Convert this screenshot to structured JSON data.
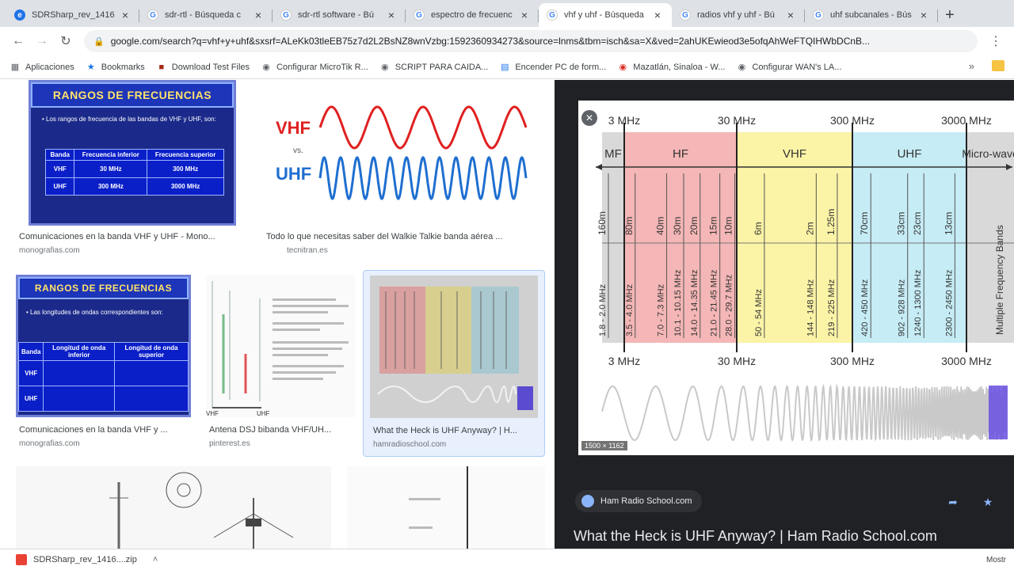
{
  "tabs": [
    {
      "title": "SDRSharp_rev_1416",
      "icon": "edge",
      "active": false
    },
    {
      "title": "sdr-rtl - Búsqueda c",
      "icon": "g",
      "active": false
    },
    {
      "title": "sdr-rtl software - Bú",
      "icon": "g",
      "active": false
    },
    {
      "title": "espectro de frecuenc",
      "icon": "g",
      "active": false
    },
    {
      "title": "vhf y uhf - Búsqueda",
      "icon": "g",
      "active": true
    },
    {
      "title": "radios vhf y uhf - Bú",
      "icon": "g",
      "active": false
    },
    {
      "title": "uhf subcanales - Bús",
      "icon": "g",
      "active": false
    }
  ],
  "toolbar": {
    "url": "google.com/search?q=vhf+y+uhf&sxsrf=ALeKk03tleEB75z7d2L2BsNZ8wnVzbg:1592360934273&source=lnms&tbm=isch&sa=X&ved=2ahUKEwieod3e5ofqAhWeFTQIHWbDCnB..."
  },
  "bookmarks": [
    {
      "label": "Aplicaciones",
      "icon": "apps"
    },
    {
      "label": "Bookmarks",
      "icon": "star"
    },
    {
      "label": "Download Test Files",
      "icon": "square"
    },
    {
      "label": "Configurar MicroTik R...",
      "icon": "circle"
    },
    {
      "label": "SCRIPT PARA CAIDA...",
      "icon": "circle"
    },
    {
      "label": "Encender PC de form...",
      "icon": "doc"
    },
    {
      "label": "Mazatlán, Sinaloa - W...",
      "icon": "circle-red"
    },
    {
      "label": "Configurar WAN's LA...",
      "icon": "circle"
    }
  ],
  "results": {
    "r1": {
      "caption": "Comunicaciones en la banda VHF y UHF - Mono...",
      "source": "monografias.com",
      "panel_title": "RANGOS DE FRECUENCIAS",
      "panel_text": "• Los rangos de frecuencia de las bandas de VHF y UHF, son:",
      "table_head": [
        "Banda",
        "Frecuencia inferior",
        "Frecuencia superior"
      ],
      "table_rows": [
        [
          "VHF",
          "30 MHz",
          "300 MHz"
        ],
        [
          "UHF",
          "300 MHz",
          "3000 MHz"
        ]
      ]
    },
    "r2": {
      "caption": "Todo lo que necesitas saber del Walkie Talkie banda aérea ...",
      "source": "tecnitran.es",
      "vhf": "VHF",
      "vs": "vs.",
      "uhf": "UHF"
    },
    "r3": {
      "caption": "Comunicaciones en la banda VHF y ...",
      "source": "monografias.com",
      "panel_title": "RANGOS DE FRECUENCIAS",
      "panel_text": "• Las longitudes de ondas correspondientes son:",
      "table_head": [
        "Banda",
        "Longitud de onda inferior",
        "Longitud de onda superior"
      ],
      "table_rows": [
        [
          "VHF",
          "",
          ""
        ],
        [
          "UHF",
          "",
          ""
        ]
      ]
    },
    "r4": {
      "caption": "Antena DSJ bibanda VHF/UH...",
      "source": "pinterest.es",
      "label_vhf": "VHF",
      "label_uhf": "UHF"
    },
    "r5": {
      "caption": "What the Heck is UHF Anyway? | H...",
      "source": "hamradioschool.com"
    }
  },
  "preview": {
    "size": "1500 × 1162",
    "site": "Ham Radio School.com",
    "title": "What the Heck is UHF Anyway? | Ham Radio School.com"
  },
  "chart_data": {
    "type": "table",
    "top_axis_labels": [
      "3 MHz",
      "30 MHz",
      "300 MHz",
      "3000 MHz"
    ],
    "bottom_axis_labels": [
      "3 MHz",
      "30 MHz",
      "300 MHz",
      "3000 MHz"
    ],
    "bands": [
      {
        "name": "MF",
        "color": "#d9d9d9"
      },
      {
        "name": "HF",
        "color": "#f4b6b6"
      },
      {
        "name": "VHF",
        "color": "#fbf3a6"
      },
      {
        "name": "UHF",
        "color": "#c6ecf5"
      },
      {
        "name": "Micro-wave",
        "color": "#d9d9d9"
      }
    ],
    "hf_bands": [
      {
        "wavelength": "160m",
        "freq": "1.8 - 2.0 MHz"
      },
      {
        "wavelength": "80m",
        "freq": "3.5 - 4.0 MHz"
      },
      {
        "wavelength": "40m",
        "freq": "7.0 - 7.3 MHz"
      },
      {
        "wavelength": "30m",
        "freq": "10.1 - 10.15 MHz"
      },
      {
        "wavelength": "20m",
        "freq": "14.0 - 14.35 MHz"
      },
      {
        "wavelength": "15m",
        "freq": "21.0 - 21.45 MHz"
      },
      {
        "wavelength": "10m",
        "freq": "28.0 - 29.7 MHz"
      }
    ],
    "vhf_bands": [
      {
        "wavelength": "6m",
        "freq": "50 - 54 MHz"
      },
      {
        "wavelength": "2m",
        "freq": "144 - 148 MHz"
      },
      {
        "wavelength": "1.25m",
        "freq": "219 - 225 MHz"
      }
    ],
    "uhf_bands": [
      {
        "wavelength": "70cm",
        "freq": "420 - 450 MHz"
      },
      {
        "wavelength": "33cm",
        "freq": "902 - 928 MHz"
      },
      {
        "wavelength": "23cm",
        "freq": "1240 - 1300 MHz"
      },
      {
        "wavelength": "13cm",
        "freq": "2300 - 2450 MHz"
      }
    ],
    "microwave_label": "Multiple Frequency Bands"
  },
  "downloads": {
    "file": "SDRSharp_rev_1416....zip",
    "right": "Mostr"
  }
}
